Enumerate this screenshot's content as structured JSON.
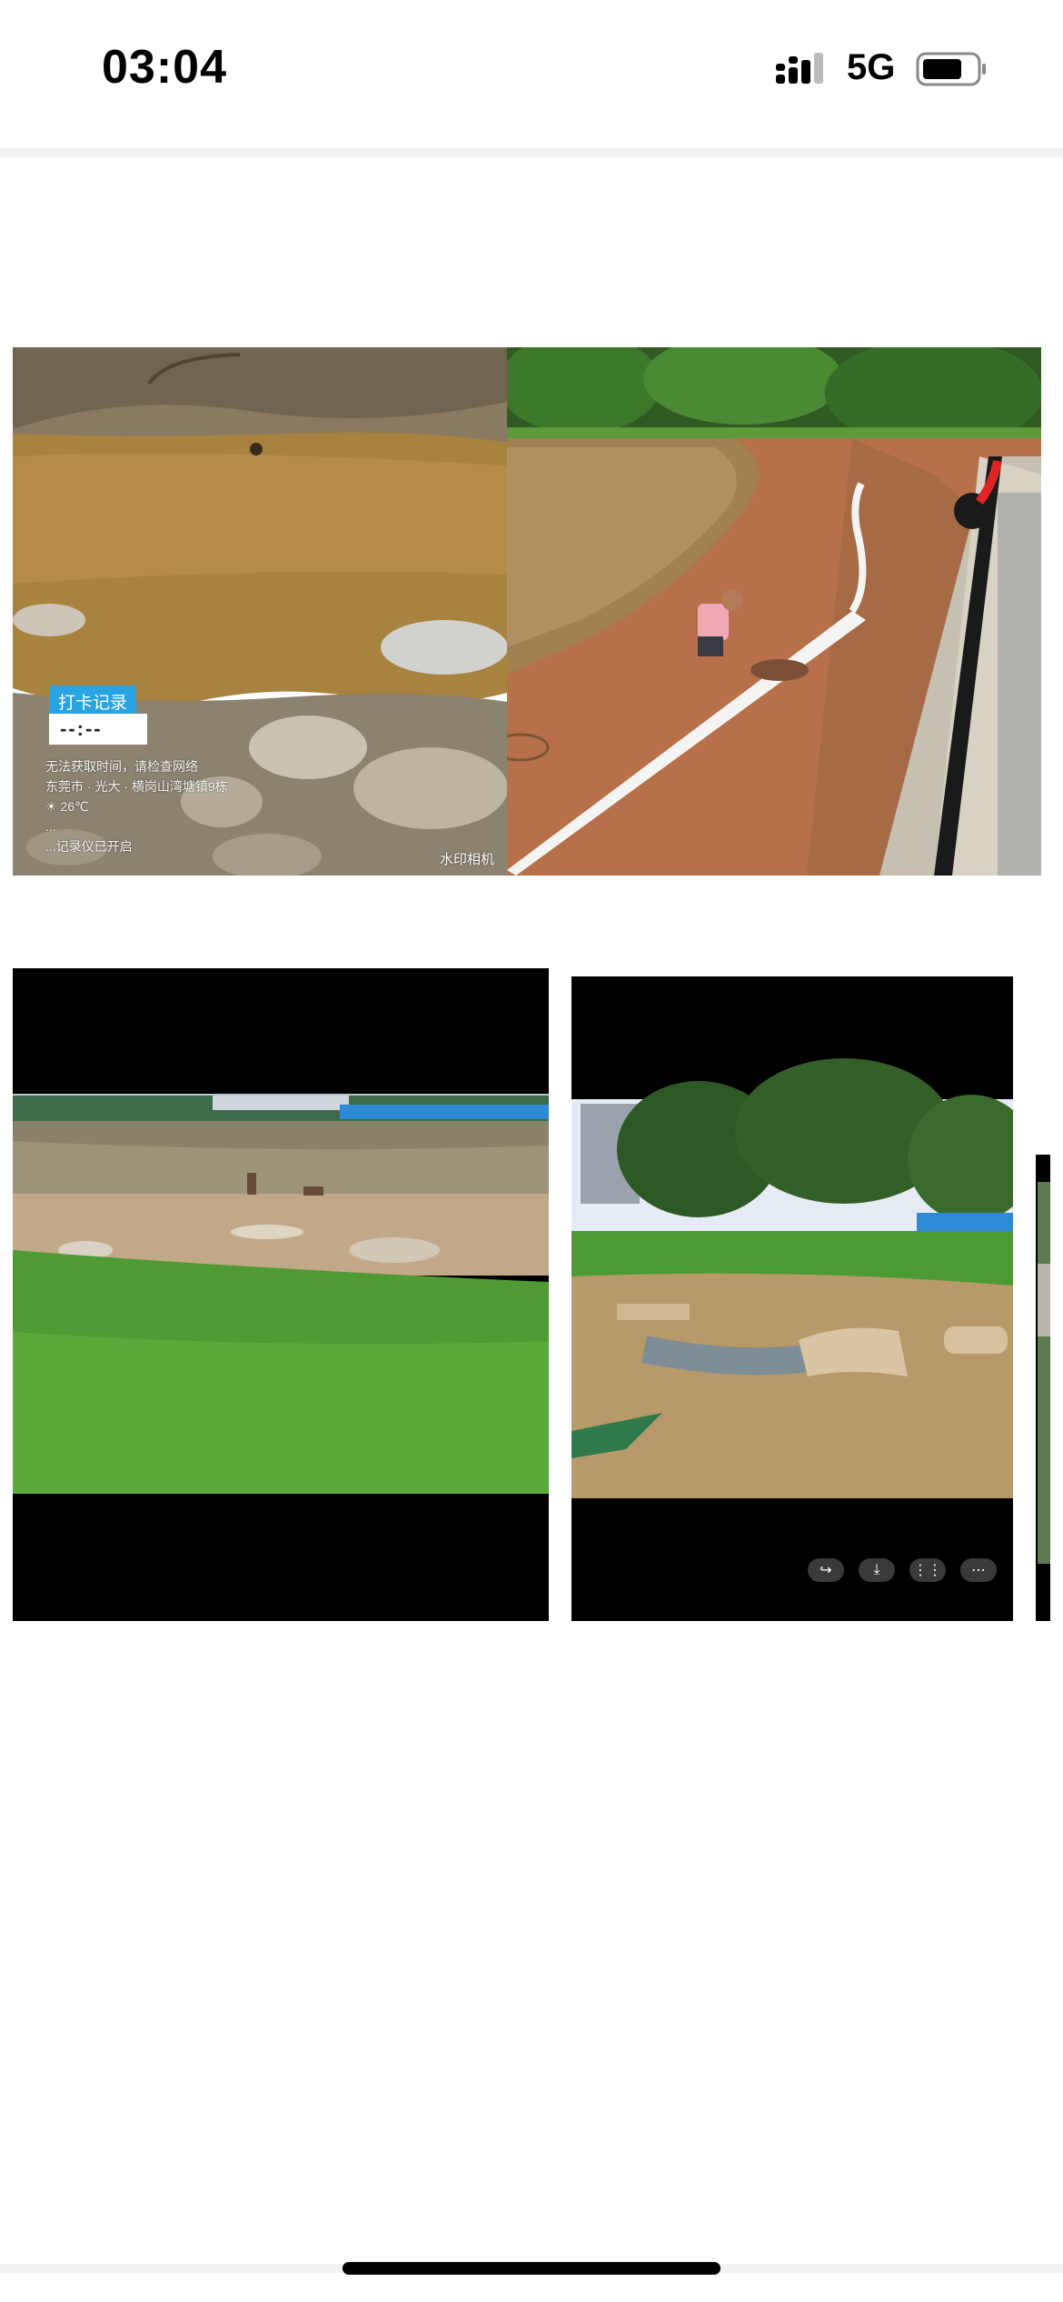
{
  "status_bar": {
    "time": "03:04",
    "network": "5G",
    "icons": [
      "signal-icon",
      "battery-icon"
    ]
  },
  "photos": [
    {
      "name": "photo-muddy-pond-swimmer",
      "watermark": {
        "badge": "打卡记录",
        "time": "--:--",
        "lines": [
          "无法获取时间，请检查网络",
          "东莞市 · 光大 · 横岗山湾塘镇9栋",
          "☀ 26℃",
          "...",
          "...记录仪已开启"
        ],
        "brand": "水印相机"
      }
    },
    {
      "name": "photo-worker-with-pipe"
    },
    {
      "name": "photo-lake-shore-grass"
    },
    {
      "name": "photo-drainage-ditch"
    },
    {
      "name": "photo-partial-edge"
    }
  ],
  "media_controls": {
    "buttons": [
      {
        "name": "share-button",
        "icon": "↪"
      },
      {
        "name": "save-button",
        "icon": "⤓"
      },
      {
        "name": "grid-button",
        "icon": "⋮⋮"
      },
      {
        "name": "more-button",
        "icon": "⋯"
      }
    ]
  },
  "colors": {
    "background": "#ffffff",
    "watermark_badge": "#2aa3e3",
    "status_text": "#000000"
  }
}
